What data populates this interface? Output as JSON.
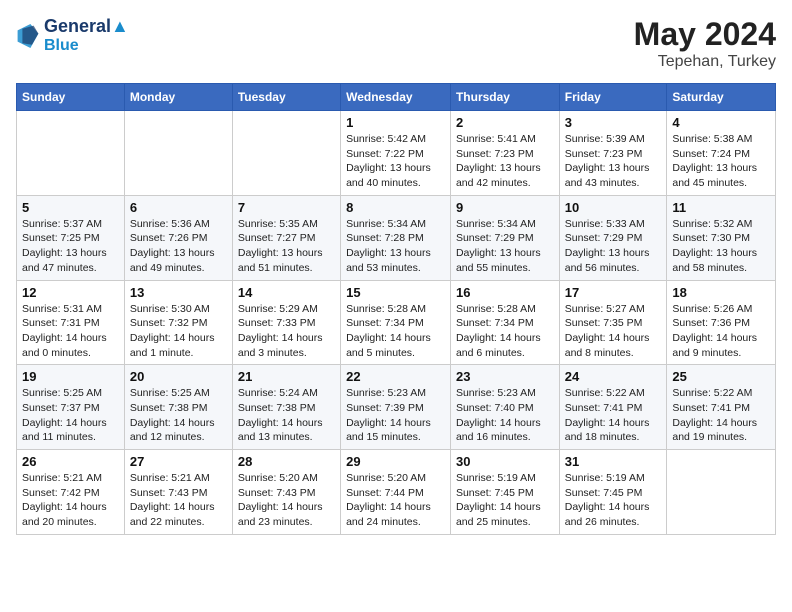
{
  "header": {
    "logo_line1": "General",
    "logo_line2": "Blue",
    "title": "May 2024",
    "location": "Tepehan, Turkey"
  },
  "weekdays": [
    "Sunday",
    "Monday",
    "Tuesday",
    "Wednesday",
    "Thursday",
    "Friday",
    "Saturday"
  ],
  "weeks": [
    [
      {
        "day": "",
        "info": ""
      },
      {
        "day": "",
        "info": ""
      },
      {
        "day": "",
        "info": ""
      },
      {
        "day": "1",
        "info": "Sunrise: 5:42 AM\nSunset: 7:22 PM\nDaylight: 13 hours\nand 40 minutes."
      },
      {
        "day": "2",
        "info": "Sunrise: 5:41 AM\nSunset: 7:23 PM\nDaylight: 13 hours\nand 42 minutes."
      },
      {
        "day": "3",
        "info": "Sunrise: 5:39 AM\nSunset: 7:23 PM\nDaylight: 13 hours\nand 43 minutes."
      },
      {
        "day": "4",
        "info": "Sunrise: 5:38 AM\nSunset: 7:24 PM\nDaylight: 13 hours\nand 45 minutes."
      }
    ],
    [
      {
        "day": "5",
        "info": "Sunrise: 5:37 AM\nSunset: 7:25 PM\nDaylight: 13 hours\nand 47 minutes."
      },
      {
        "day": "6",
        "info": "Sunrise: 5:36 AM\nSunset: 7:26 PM\nDaylight: 13 hours\nand 49 minutes."
      },
      {
        "day": "7",
        "info": "Sunrise: 5:35 AM\nSunset: 7:27 PM\nDaylight: 13 hours\nand 51 minutes."
      },
      {
        "day": "8",
        "info": "Sunrise: 5:34 AM\nSunset: 7:28 PM\nDaylight: 13 hours\nand 53 minutes."
      },
      {
        "day": "9",
        "info": "Sunrise: 5:34 AM\nSunset: 7:29 PM\nDaylight: 13 hours\nand 55 minutes."
      },
      {
        "day": "10",
        "info": "Sunrise: 5:33 AM\nSunset: 7:29 PM\nDaylight: 13 hours\nand 56 minutes."
      },
      {
        "day": "11",
        "info": "Sunrise: 5:32 AM\nSunset: 7:30 PM\nDaylight: 13 hours\nand 58 minutes."
      }
    ],
    [
      {
        "day": "12",
        "info": "Sunrise: 5:31 AM\nSunset: 7:31 PM\nDaylight: 14 hours\nand 0 minutes."
      },
      {
        "day": "13",
        "info": "Sunrise: 5:30 AM\nSunset: 7:32 PM\nDaylight: 14 hours\nand 1 minute."
      },
      {
        "day": "14",
        "info": "Sunrise: 5:29 AM\nSunset: 7:33 PM\nDaylight: 14 hours\nand 3 minutes."
      },
      {
        "day": "15",
        "info": "Sunrise: 5:28 AM\nSunset: 7:34 PM\nDaylight: 14 hours\nand 5 minutes."
      },
      {
        "day": "16",
        "info": "Sunrise: 5:28 AM\nSunset: 7:34 PM\nDaylight: 14 hours\nand 6 minutes."
      },
      {
        "day": "17",
        "info": "Sunrise: 5:27 AM\nSunset: 7:35 PM\nDaylight: 14 hours\nand 8 minutes."
      },
      {
        "day": "18",
        "info": "Sunrise: 5:26 AM\nSunset: 7:36 PM\nDaylight: 14 hours\nand 9 minutes."
      }
    ],
    [
      {
        "day": "19",
        "info": "Sunrise: 5:25 AM\nSunset: 7:37 PM\nDaylight: 14 hours\nand 11 minutes."
      },
      {
        "day": "20",
        "info": "Sunrise: 5:25 AM\nSunset: 7:38 PM\nDaylight: 14 hours\nand 12 minutes."
      },
      {
        "day": "21",
        "info": "Sunrise: 5:24 AM\nSunset: 7:38 PM\nDaylight: 14 hours\nand 13 minutes."
      },
      {
        "day": "22",
        "info": "Sunrise: 5:23 AM\nSunset: 7:39 PM\nDaylight: 14 hours\nand 15 minutes."
      },
      {
        "day": "23",
        "info": "Sunrise: 5:23 AM\nSunset: 7:40 PM\nDaylight: 14 hours\nand 16 minutes."
      },
      {
        "day": "24",
        "info": "Sunrise: 5:22 AM\nSunset: 7:41 PM\nDaylight: 14 hours\nand 18 minutes."
      },
      {
        "day": "25",
        "info": "Sunrise: 5:22 AM\nSunset: 7:41 PM\nDaylight: 14 hours\nand 19 minutes."
      }
    ],
    [
      {
        "day": "26",
        "info": "Sunrise: 5:21 AM\nSunset: 7:42 PM\nDaylight: 14 hours\nand 20 minutes."
      },
      {
        "day": "27",
        "info": "Sunrise: 5:21 AM\nSunset: 7:43 PM\nDaylight: 14 hours\nand 22 minutes."
      },
      {
        "day": "28",
        "info": "Sunrise: 5:20 AM\nSunset: 7:43 PM\nDaylight: 14 hours\nand 23 minutes."
      },
      {
        "day": "29",
        "info": "Sunrise: 5:20 AM\nSunset: 7:44 PM\nDaylight: 14 hours\nand 24 minutes."
      },
      {
        "day": "30",
        "info": "Sunrise: 5:19 AM\nSunset: 7:45 PM\nDaylight: 14 hours\nand 25 minutes."
      },
      {
        "day": "31",
        "info": "Sunrise: 5:19 AM\nSunset: 7:45 PM\nDaylight: 14 hours\nand 26 minutes."
      },
      {
        "day": "",
        "info": ""
      }
    ]
  ]
}
